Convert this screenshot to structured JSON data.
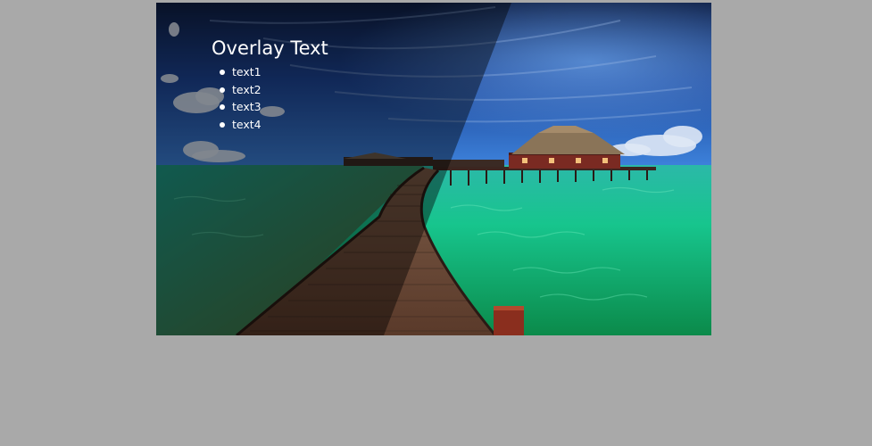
{
  "overlay": {
    "title": "Overlay Text",
    "items": [
      {
        "label": "text1"
      },
      {
        "label": "text2"
      },
      {
        "label": "text3"
      },
      {
        "label": "text4"
      }
    ]
  },
  "image": {
    "subject": "tropical-over-water-bungalow-boardwalk",
    "colors": {
      "sky_dark": "#16264a",
      "sky_light": "#2f6fd6",
      "water": "#1fcf9a",
      "boardwalk": "#6a4a38",
      "page_background": "#a9a9a9"
    }
  }
}
